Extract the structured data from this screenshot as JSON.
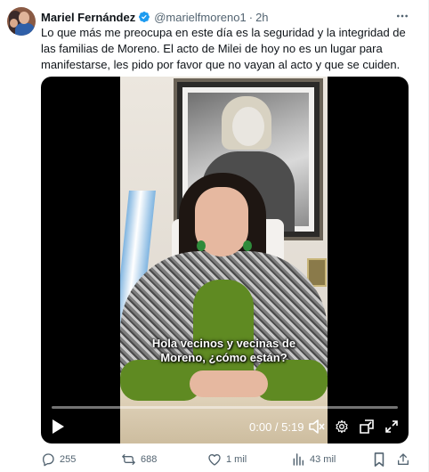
{
  "tweet": {
    "author_name": "Mariel Fernández",
    "handle": "@marielfmoreno1",
    "separator": "·",
    "time": "2h",
    "text": "Lo que más me preocupa en este día es la seguridad y la integridad de las familias de Moreno. El acto de Milei de hoy no es un lugar para manifestarse, les pido por favor que no vayan al acto y que se cuiden."
  },
  "video": {
    "caption_line1": "Hola vecinos y vecinas de",
    "caption_line2": "Moreno, ¿cómo están?",
    "timecode": "0:00 / 5:19",
    "progress_fraction": 0.0
  },
  "actions": {
    "replies": "255",
    "reposts": "688",
    "likes": "1 mil",
    "views": "43 mil"
  },
  "icons": {
    "verified": "verified-badge-icon",
    "more": "more-icon",
    "play": "play-icon",
    "volume": "volume-icon",
    "settings": "settings-icon",
    "pip": "picture-in-picture-icon",
    "fullscreen": "fullscreen-icon",
    "reply": "reply-icon",
    "repost": "repost-icon",
    "like": "like-icon",
    "views": "views-icon",
    "bookmark": "bookmark-icon",
    "share": "share-icon"
  },
  "colors": {
    "accent": "#1d9bf0",
    "text_primary": "#0f1419",
    "text_secondary": "#536471"
  }
}
